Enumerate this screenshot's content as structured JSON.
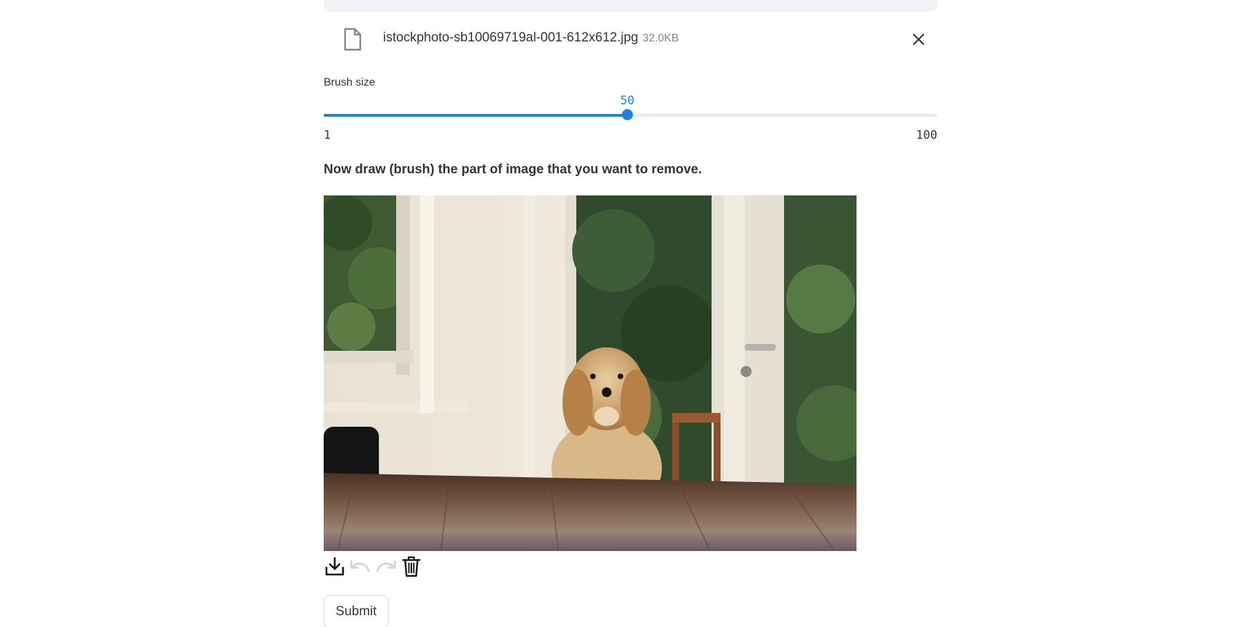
{
  "uploader": {
    "file_name": "istockphoto-sb10069719al-001-612x612.jpg",
    "file_size": "32.0KB",
    "file_icon": "file-icon",
    "remove_icon": "close-icon"
  },
  "slider": {
    "label": "Brush size",
    "value": "50",
    "min": "1",
    "max": "100",
    "accent": "#1c83e1"
  },
  "instruction": "Now draw (brush) the part of image that you want to remove.",
  "canvas": {
    "image_subject": "golden retriever at wooden table"
  },
  "toolbar": {
    "download_icon": "download-icon",
    "undo_icon": "undo-icon",
    "redo_icon": "redo-icon",
    "delete_icon": "trash-icon"
  },
  "submit": {
    "label": "Submit"
  }
}
